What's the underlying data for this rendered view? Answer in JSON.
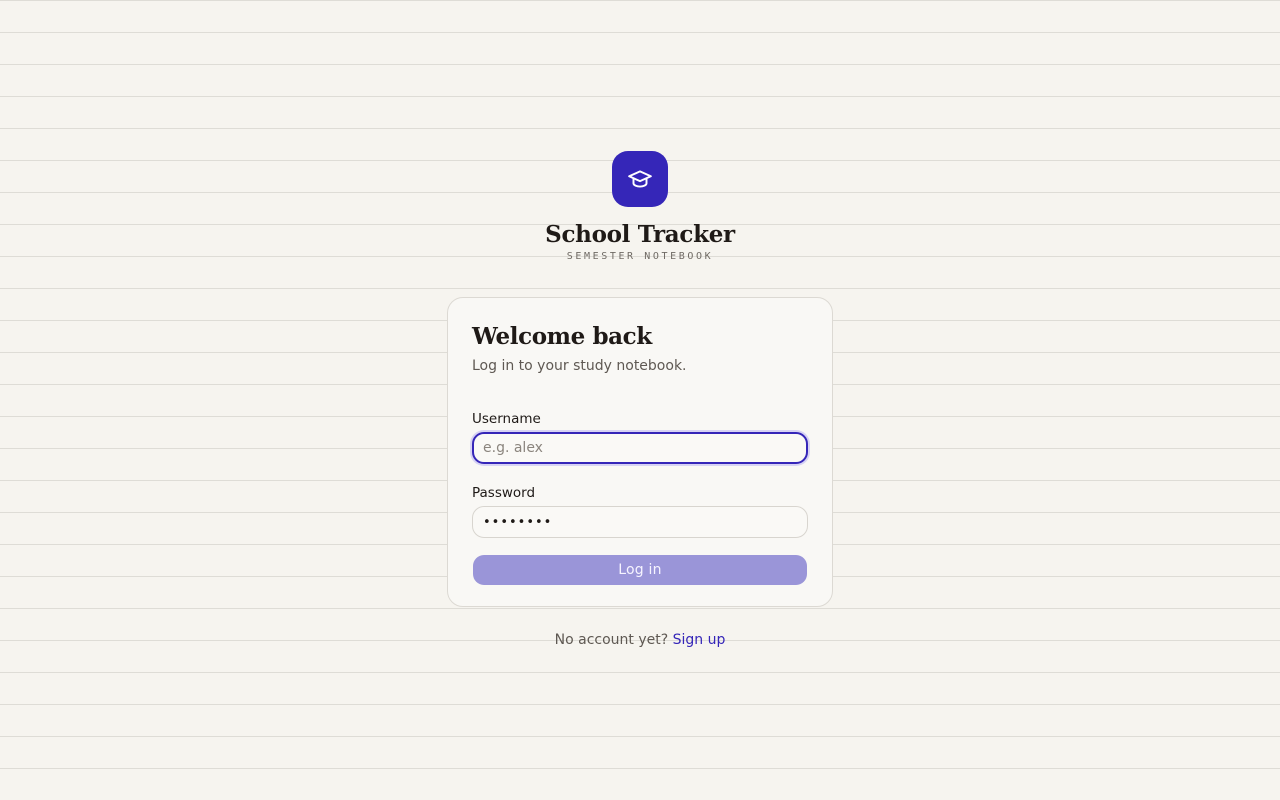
{
  "brand": {
    "icon": "graduation-cap-icon",
    "title": "School Tracker",
    "subtitle": "SEMESTER NOTEBOOK",
    "accent_color": "#3526b8"
  },
  "login": {
    "heading": "Welcome back",
    "subheading": "Log in to your study notebook.",
    "username": {
      "label": "Username",
      "placeholder": "e.g. alex",
      "value": ""
    },
    "password": {
      "label": "Password",
      "value": "••••••••"
    },
    "submit_label": "Log in",
    "button_color": "#9a95d8"
  },
  "footer": {
    "prompt": "No account yet?",
    "signup_label": "Sign up"
  }
}
